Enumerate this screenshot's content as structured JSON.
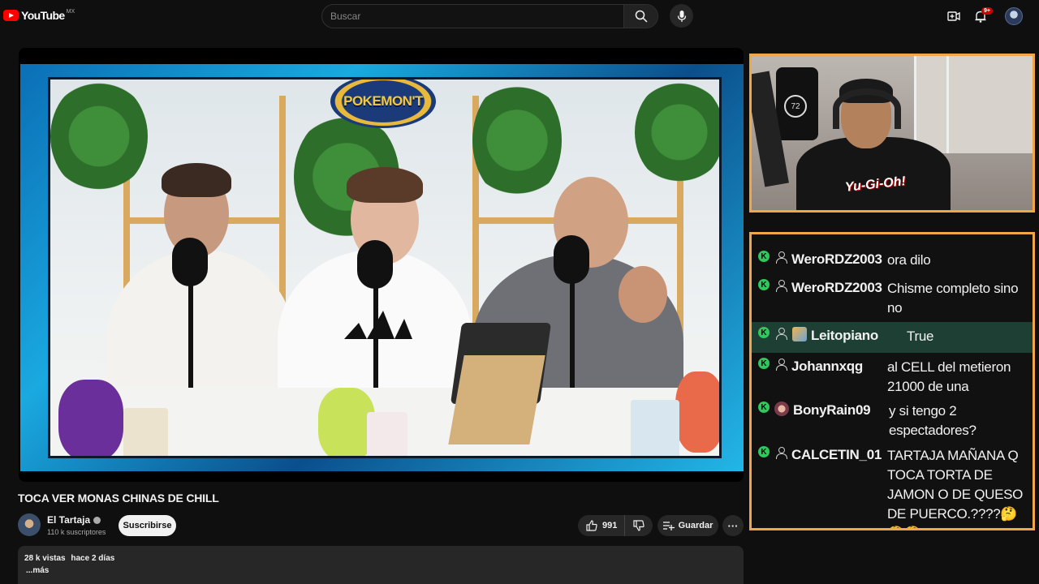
{
  "header": {
    "logo_text": "YouTube",
    "logo_country": "MX",
    "search_placeholder": "Buscar",
    "notification_count": "9+",
    "icons": [
      "search-icon",
      "mic-icon",
      "create-icon",
      "bell-icon",
      "account-avatar"
    ]
  },
  "video": {
    "show_logo": "POKEMON'T",
    "title": "TOCA VER MONAS CHINAS DE CHILL"
  },
  "webcam": {
    "shirt_text": "Yu-Gi-Oh!",
    "jersey_number": "72"
  },
  "chat": {
    "messages": [
      {
        "user": "WeroRDZ2003",
        "text": "ora dilo",
        "avatar": "user-icon",
        "highlighted": false
      },
      {
        "user": "WeroRDZ2003",
        "text": "Chisme completo sino no",
        "avatar": "user-icon",
        "highlighted": false
      },
      {
        "user": "Leitopiano",
        "text": "True",
        "avatar": "custom-avatar",
        "highlighted": true
      },
      {
        "user": "Johannxqg",
        "text": "al CELL del metieron 21000 de una",
        "avatar": "user-icon",
        "highlighted": false
      },
      {
        "user": "BonyRain09",
        "text": "y si tengo 2 espectadores?",
        "avatar": "custom-avatar",
        "highlighted": false
      },
      {
        "user": "CALCETIN_01",
        "text": "TARTAJA MAÑANA Q TOCA TORTA DE JAMON O DE QUESO DE PUERCO.????🤔🤔🤔",
        "avatar": "user-icon",
        "highlighted": false
      }
    ]
  },
  "channel": {
    "name": "El Tartaja",
    "subscribers": "110 k suscriptores",
    "subscribe_label": "Suscribirse"
  },
  "actions": {
    "likes": "991",
    "save_label": "Guardar",
    "more_label": "···"
  },
  "description": {
    "views": "28 k vistas",
    "date": "hace 2 días",
    "more": "...más"
  },
  "colors": {
    "background": "#0f0f0f",
    "overlay_border": "#f2a64a",
    "kick_green": "#2ec95c",
    "highlight_row": "#1e4034",
    "brand_red": "#ff0000"
  }
}
